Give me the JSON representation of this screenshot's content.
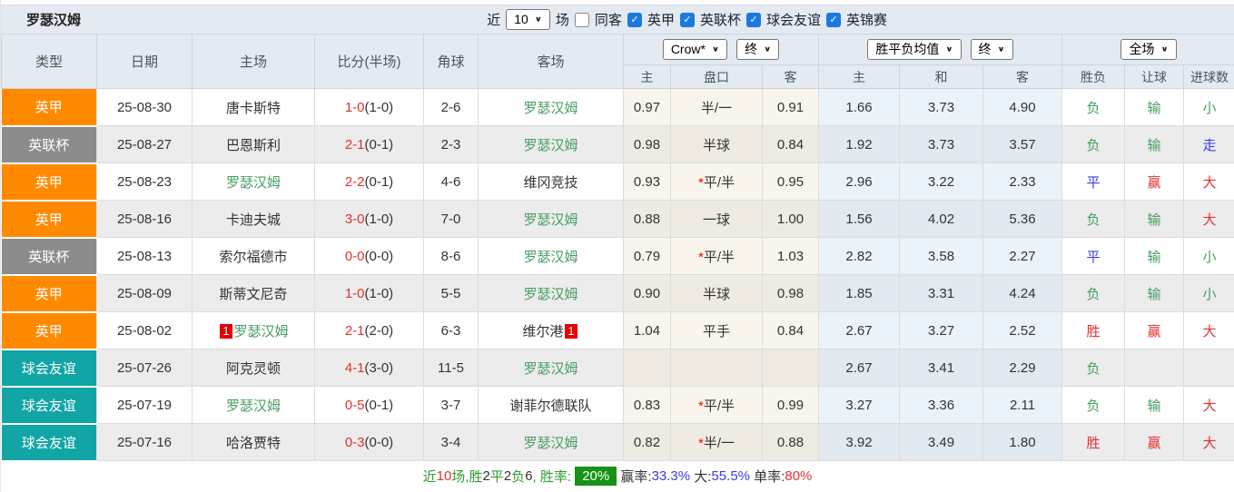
{
  "header_bar": {
    "team_name": "罗瑟汉姆",
    "recent_label": "近",
    "recent_select_value": "10",
    "matches_label": "场",
    "same_opponent_label": "同客",
    "filters": [
      {
        "label": "英甲",
        "checked": true
      },
      {
        "label": "英联杯",
        "checked": true
      },
      {
        "label": "球会友谊",
        "checked": true
      },
      {
        "label": "英锦赛",
        "checked": true
      }
    ]
  },
  "table": {
    "columns": {
      "type": "类型",
      "date": "日期",
      "home": "主场",
      "score": "比分(半场)",
      "corner": "角球",
      "away": "客场"
    },
    "selects": {
      "asian_company": "Crow*",
      "asian_time": "终",
      "euro_type": "胜平负均值",
      "euro_time": "终",
      "scope": "全场"
    },
    "sub_headers": {
      "asian_home": "主",
      "handicap": "盘口",
      "asian_away": "客",
      "euro_home": "主",
      "euro_draw": "和",
      "euro_away": "客",
      "result": "胜负",
      "handicap_result": "让球",
      "goals": "进球数"
    }
  },
  "rows": [
    {
      "type": "英甲",
      "type_color": "orange",
      "date": "25-08-30",
      "home": "唐卡斯特",
      "home_color": "black",
      "home_badge": "",
      "score_ft": "1-0",
      "score_ht": "(1-0)",
      "corner": "2-6",
      "away": "罗瑟汉姆",
      "away_color": "green",
      "away_badge": "",
      "asian_home": "0.97",
      "handicap_star": "",
      "handicap": "半/一",
      "asian_away": "0.91",
      "euro_home": "1.66",
      "euro_draw": "3.73",
      "euro_away": "4.90",
      "result": "负",
      "result_color": "green",
      "handicap_result": "输",
      "handicap_result_color": "green",
      "goals": "小",
      "goals_color": "green"
    },
    {
      "type": "英联杯",
      "type_color": "gray",
      "date": "25-08-27",
      "home": "巴恩斯利",
      "home_color": "black",
      "home_badge": "",
      "score_ft": "2-1",
      "score_ht": "(0-1)",
      "corner": "2-3",
      "away": "罗瑟汉姆",
      "away_color": "green",
      "away_badge": "",
      "asian_home": "0.98",
      "handicap_star": "",
      "handicap": "半球",
      "asian_away": "0.84",
      "euro_home": "1.92",
      "euro_draw": "3.73",
      "euro_away": "3.57",
      "result": "负",
      "result_color": "green",
      "handicap_result": "输",
      "handicap_result_color": "green",
      "goals": "走",
      "goals_color": "blue"
    },
    {
      "type": "英甲",
      "type_color": "orange",
      "date": "25-08-23",
      "home": "罗瑟汉姆",
      "home_color": "green",
      "home_badge": "",
      "score_ft": "2-2",
      "score_ht": "(0-1)",
      "corner": "4-6",
      "away": "维冈竞技",
      "away_color": "black",
      "away_badge": "",
      "asian_home": "0.93",
      "handicap_star": "*",
      "handicap": "平/半",
      "asian_away": "0.95",
      "euro_home": "2.96",
      "euro_draw": "3.22",
      "euro_away": "2.33",
      "result": "平",
      "result_color": "blue",
      "handicap_result": "赢",
      "handicap_result_color": "red",
      "goals": "大",
      "goals_color": "red"
    },
    {
      "type": "英甲",
      "type_color": "orange",
      "date": "25-08-16",
      "home": "卡迪夫城",
      "home_color": "black",
      "home_badge": "",
      "score_ft": "3-0",
      "score_ht": "(1-0)",
      "corner": "7-0",
      "away": "罗瑟汉姆",
      "away_color": "green",
      "away_badge": "",
      "asian_home": "0.88",
      "handicap_star": "",
      "handicap": "一球",
      "asian_away": "1.00",
      "euro_home": "1.56",
      "euro_draw": "4.02",
      "euro_away": "5.36",
      "result": "负",
      "result_color": "green",
      "handicap_result": "输",
      "handicap_result_color": "green",
      "goals": "大",
      "goals_color": "red"
    },
    {
      "type": "英联杯",
      "type_color": "gray",
      "date": "25-08-13",
      "home": "索尔福德市",
      "home_color": "black",
      "home_badge": "",
      "score_ft": "0-0",
      "score_ht": "(0-0)",
      "corner": "8-6",
      "away": "罗瑟汉姆",
      "away_color": "green",
      "away_badge": "",
      "asian_home": "0.79",
      "handicap_star": "*",
      "handicap": "平/半",
      "asian_away": "1.03",
      "euro_home": "2.82",
      "euro_draw": "3.58",
      "euro_away": "2.27",
      "result": "平",
      "result_color": "blue",
      "handicap_result": "输",
      "handicap_result_color": "green",
      "goals": "小",
      "goals_color": "green"
    },
    {
      "type": "英甲",
      "type_color": "orange",
      "date": "25-08-09",
      "home": "斯蒂文尼奇",
      "home_color": "black",
      "home_badge": "",
      "score_ft": "1-0",
      "score_ht": "(1-0)",
      "corner": "5-5",
      "away": "罗瑟汉姆",
      "away_color": "green",
      "away_badge": "",
      "asian_home": "0.90",
      "handicap_star": "",
      "handicap": "半球",
      "asian_away": "0.98",
      "euro_home": "1.85",
      "euro_draw": "3.31",
      "euro_away": "4.24",
      "result": "负",
      "result_color": "green",
      "handicap_result": "输",
      "handicap_result_color": "green",
      "goals": "小",
      "goals_color": "green"
    },
    {
      "type": "英甲",
      "type_color": "orange",
      "date": "25-08-02",
      "home": "罗瑟汉姆",
      "home_color": "green",
      "home_badge": "1",
      "score_ft": "2-1",
      "score_ht": "(2-0)",
      "corner": "6-3",
      "away": "维尔港",
      "away_color": "black",
      "away_badge": "1",
      "asian_home": "1.04",
      "handicap_star": "",
      "handicap": "平手",
      "asian_away": "0.84",
      "euro_home": "2.67",
      "euro_draw": "3.27",
      "euro_away": "2.52",
      "result": "胜",
      "result_color": "red",
      "handicap_result": "赢",
      "handicap_result_color": "red",
      "goals": "大",
      "goals_color": "red"
    },
    {
      "type": "球会友谊",
      "type_color": "teal",
      "date": "25-07-26",
      "home": "阿克灵顿",
      "home_color": "black",
      "home_badge": "",
      "score_ft": "4-1",
      "score_ht": "(3-0)",
      "corner": "11-5",
      "away": "罗瑟汉姆",
      "away_color": "green",
      "away_badge": "",
      "asian_home": "",
      "handicap_star": "",
      "handicap": "",
      "asian_away": "",
      "euro_home": "2.67",
      "euro_draw": "3.41",
      "euro_away": "2.29",
      "result": "负",
      "result_color": "green",
      "handicap_result": "",
      "handicap_result_color": "black",
      "goals": "",
      "goals_color": "black"
    },
    {
      "type": "球会友谊",
      "type_color": "teal",
      "date": "25-07-19",
      "home": "罗瑟汉姆",
      "home_color": "green",
      "home_badge": "",
      "score_ft": "0-5",
      "score_ht": "(0-1)",
      "corner": "3-7",
      "away": "谢菲尔德联队",
      "away_color": "black",
      "away_badge": "",
      "asian_home": "0.83",
      "handicap_star": "*",
      "handicap": "平/半",
      "asian_away": "0.99",
      "euro_home": "3.27",
      "euro_draw": "3.36",
      "euro_away": "2.11",
      "result": "负",
      "result_color": "green",
      "handicap_result": "输",
      "handicap_result_color": "green",
      "goals": "大",
      "goals_color": "red"
    },
    {
      "type": "球会友谊",
      "type_color": "teal",
      "date": "25-07-16",
      "home": "哈洛贾特",
      "home_color": "black",
      "home_badge": "",
      "score_ft": "0-3",
      "score_ht": "(0-0)",
      "corner": "3-4",
      "away": "罗瑟汉姆",
      "away_color": "green",
      "away_badge": "",
      "asian_home": "0.82",
      "handicap_star": "*",
      "handicap": "半/一",
      "asian_away": "0.88",
      "euro_home": "3.92",
      "euro_draw": "3.49",
      "euro_away": "1.80",
      "result": "胜",
      "result_color": "red",
      "handicap_result": "赢",
      "handicap_result_color": "red",
      "goals": "大",
      "goals_color": "red"
    }
  ],
  "footer": {
    "segments": [
      {
        "text": "近",
        "color": "fgreen"
      },
      {
        "text": "10",
        "color": "red"
      },
      {
        "text": "场,胜",
        "color": "fgreen"
      },
      {
        "text": "2",
        "color": "black"
      },
      {
        "text": "平",
        "color": "fgreen"
      },
      {
        "text": "2",
        "color": "black"
      },
      {
        "text": "负",
        "color": "fgreen"
      },
      {
        "text": "6",
        "color": "black"
      },
      {
        "text": ", 胜率: ",
        "color": "fgreen"
      },
      {
        "text": "20%",
        "color": "badge-green"
      },
      {
        "text": " 赢率:",
        "color": "black"
      },
      {
        "text": "33.3%",
        "color": "blue"
      },
      {
        "text": " 大:",
        "color": "black"
      },
      {
        "text": "55.5%",
        "color": "blue"
      },
      {
        "text": " 单率:",
        "color": "black"
      },
      {
        "text": "80%",
        "color": "red"
      }
    ]
  },
  "colors": {
    "league_england_one": "#FF8A00",
    "league_efl_trophy": "#8C8C8C",
    "club_friendly": "#11A5A6",
    "win_red": "#E33030",
    "lose_green": "#459E5E",
    "draw_blue": "#3C3CDF",
    "checkbox_blue": "#1B79E0",
    "rate_badge_green": "#169316"
  }
}
